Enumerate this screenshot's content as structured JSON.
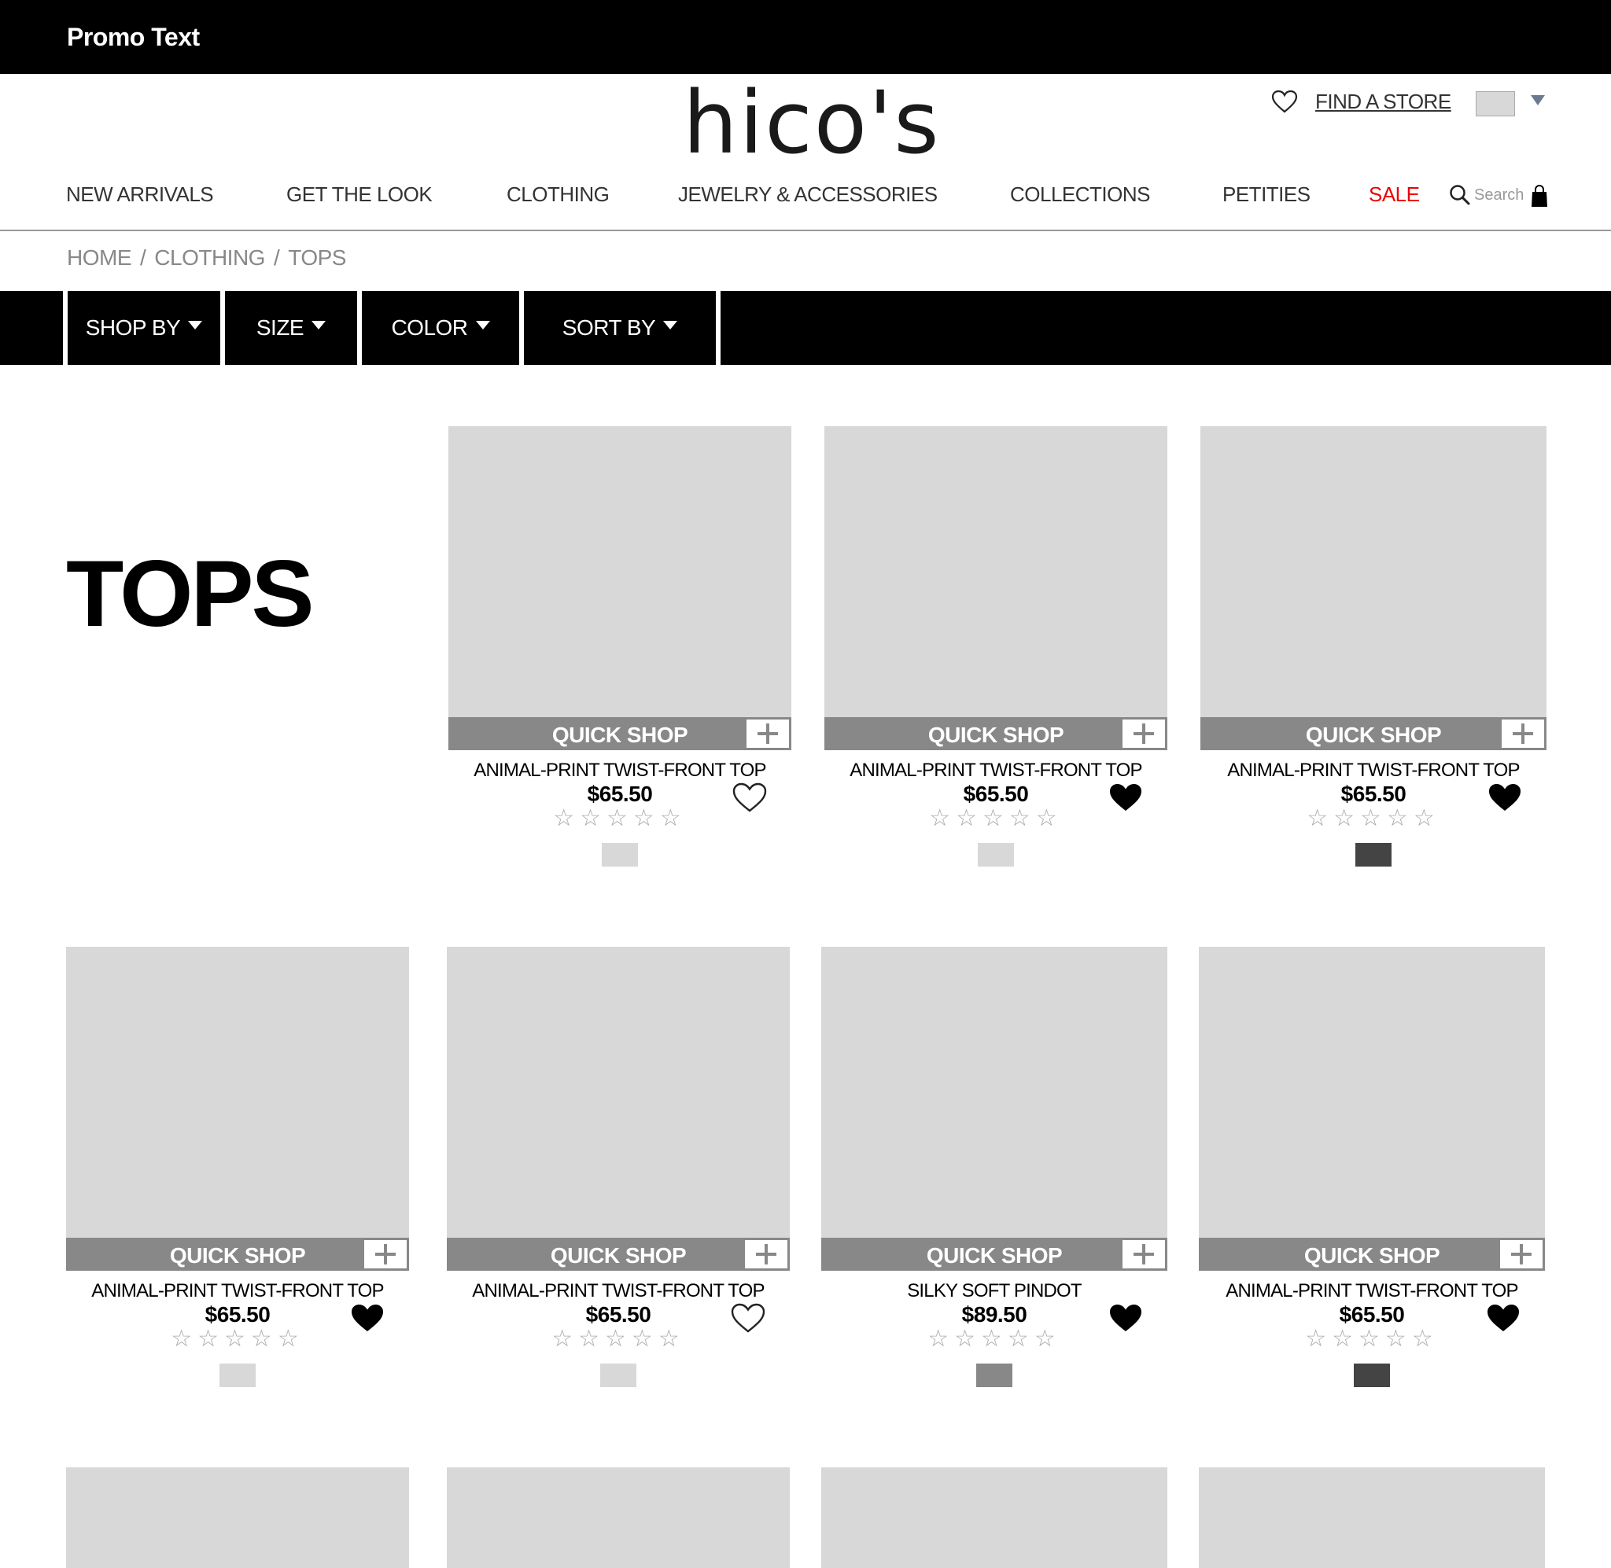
{
  "promo": {
    "text": "Promo Text"
  },
  "header": {
    "logo": "hico's",
    "find_store": "FIND A STORE"
  },
  "nav": {
    "items": [
      "NEW ARRIVALS",
      "GET THE LOOK",
      "CLOTHING",
      "JEWELRY & ACCESSORIES",
      "COLLECTIONS",
      "PETITIES",
      "SALE"
    ],
    "search_placeholder": "Search"
  },
  "breadcrumb": {
    "items": [
      "HOME",
      "CLOTHING",
      "TOPS"
    ],
    "separator": "/"
  },
  "filters": [
    "SHOP BY",
    "SIZE",
    "COLOR",
    "SORT BY"
  ],
  "page": {
    "title": "TOPS"
  },
  "colors": {
    "sale": "#ee0000",
    "quick_shop_bar": "#888888",
    "placeholder": "#d8d8d8"
  },
  "quick_shop_label": "QUICK SHOP",
  "stars_glyph": "☆☆☆☆☆",
  "products": [
    {
      "name": "ANIMAL-PRINT TWIST-FRONT TOP",
      "price": "$65.50",
      "favorited": false,
      "rating": 0,
      "swatch": "#d8d8d8"
    },
    {
      "name": "ANIMAL-PRINT TWIST-FRONT TOP",
      "price": "$65.50",
      "favorited": true,
      "rating": 0,
      "swatch": "#d8d8d8"
    },
    {
      "name": "ANIMAL-PRINT TWIST-FRONT TOP",
      "price": "$65.50",
      "favorited": true,
      "rating": 0,
      "swatch": "#444444"
    },
    {
      "name": "ANIMAL-PRINT TWIST-FRONT TOP",
      "price": "$65.50",
      "favorited": true,
      "rating": 0,
      "swatch": "#d8d8d8"
    },
    {
      "name": "ANIMAL-PRINT TWIST-FRONT TOP",
      "price": "$65.50",
      "favorited": false,
      "rating": 0,
      "swatch": "#d8d8d8"
    },
    {
      "name": "SILKY SOFT PINDOT",
      "price": "$89.50",
      "favorited": true,
      "rating": 0,
      "swatch": "#888888"
    },
    {
      "name": "ANIMAL-PRINT TWIST-FRONT TOP",
      "price": "$65.50",
      "favorited": true,
      "rating": 0,
      "swatch": "#444444"
    }
  ]
}
